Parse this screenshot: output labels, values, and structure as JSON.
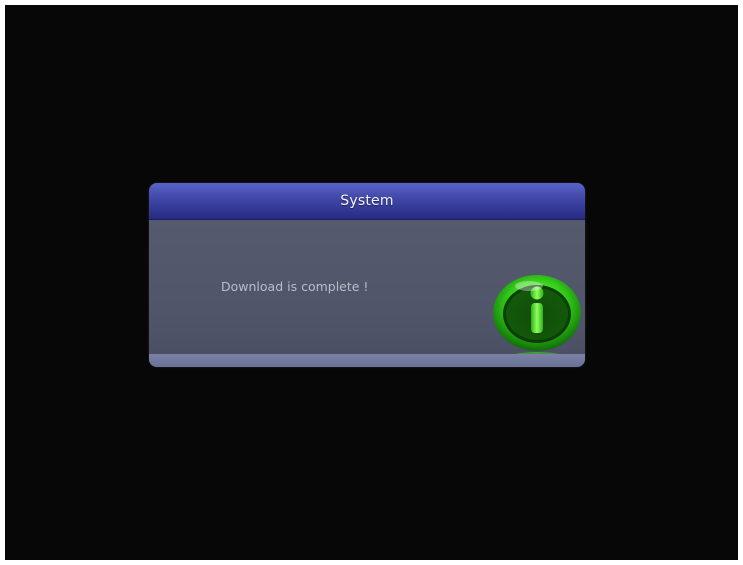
{
  "dialog": {
    "title": "System",
    "message": "Download is complete !",
    "icon": "info-icon"
  },
  "colors": {
    "background": "#070707",
    "dialog_body": "#50556a",
    "title_bar": "#3f46a6",
    "icon_green": "#31d21a",
    "text": "#b8bcc8"
  }
}
